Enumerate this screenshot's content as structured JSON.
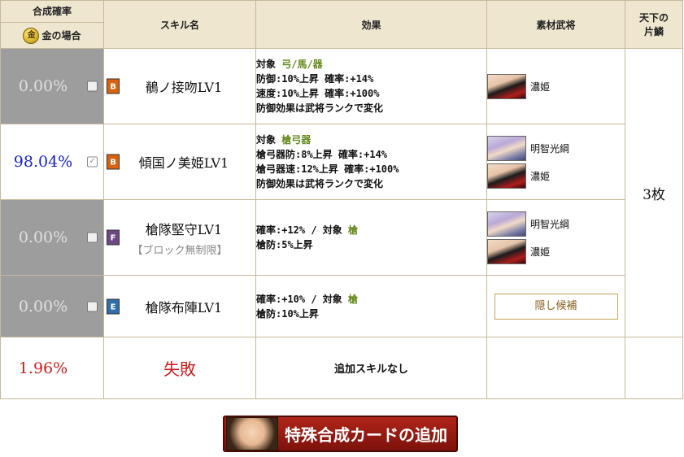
{
  "header": {
    "rate_title": "合成確率",
    "gold_coin": "金",
    "gold_case": "金の場合",
    "skill_name": "スキル名",
    "effect": "効果",
    "materials": "素材武将",
    "tenka_line1": "天下の",
    "tenka_line2": "片鱗"
  },
  "rows": [
    {
      "rate": "0.00%",
      "checked": false,
      "rank": "B",
      "skill": "鶺ノ接吻LV1",
      "effect_lines": [
        [
          "対象 ",
          "弓/馬/器"
        ],
        [
          "防御:10%上昇  確率:+14%"
        ],
        [
          "速度:10%上昇  確率:+100%"
        ],
        [
          "防御効果は武将ランクで変化"
        ]
      ],
      "materials": [
        "濃姫"
      ]
    },
    {
      "rate": "98.04%",
      "checked": true,
      "rank": "B",
      "skill": "傾国ノ美姫LV1",
      "effect_lines": [
        [
          "対象 ",
          "槍弓器"
        ],
        [
          "槍弓器防:8%上昇  確率:+14%"
        ],
        [
          "槍弓器速:12%上昇  確率:+100%"
        ],
        [
          "防御効果は武将ランクで変化"
        ]
      ],
      "materials": [
        "明智光綱",
        "濃姫"
      ]
    },
    {
      "rate": "0.00%",
      "checked": false,
      "rank": "F",
      "skill": "槍隊堅守LV1",
      "skill_sub": "【ブロック無制限】",
      "effect_lines": [
        [
          "確率:+12% / 対象 ",
          "槍"
        ],
        [
          "槍防:5%上昇"
        ]
      ],
      "materials": [
        "明智光綱",
        "濃姫"
      ]
    },
    {
      "rate": "0.00%",
      "checked": false,
      "rank": "E",
      "skill": "槍隊布陣LV1",
      "effect_lines": [
        [
          "確率:+10% / 対象 ",
          "槍"
        ],
        [
          "槍防:10%上昇"
        ]
      ],
      "hidden_candidate_label": "隠し候補"
    }
  ],
  "tenka_value": "3枚",
  "fail_row": {
    "rate": "1.96%",
    "label": "失敗",
    "effect": "追加スキルなし"
  },
  "add_button": {
    "label": "特殊合成カードの追加"
  }
}
